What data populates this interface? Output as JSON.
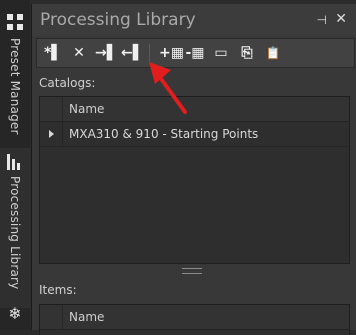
{
  "sidebar": {
    "tabs": [
      {
        "label": "Preset Manager",
        "icon": "grid-icon"
      },
      {
        "label": "Processing Library",
        "icon": "bars-icon",
        "active": true
      },
      {
        "label": "",
        "icon": "snowflake-icon"
      }
    ]
  },
  "panel": {
    "title": "Processing Library",
    "pin_glyph": "⊣",
    "close_glyph": "✕"
  },
  "toolbar": {
    "buttons": [
      {
        "name": "new-icon",
        "glyph": "*▌"
      },
      {
        "name": "delete-icon",
        "glyph": "✕"
      },
      {
        "name": "import-icon",
        "glyph": "→▌"
      },
      {
        "name": "export-icon",
        "glyph": "←▌"
      },
      {
        "name": "add-item-icon",
        "glyph": "+▦"
      },
      {
        "name": "remove-item-icon",
        "glyph": "-▦"
      },
      {
        "name": "window-icon",
        "glyph": "▭"
      },
      {
        "name": "copy-icon",
        "glyph": "⎘"
      },
      {
        "name": "paste-icon",
        "glyph": "📋"
      }
    ]
  },
  "catalogs": {
    "label": "Catalogs:",
    "column_header": "Name",
    "rows": [
      {
        "name": "MXA310 & 910 - Starting Points"
      }
    ]
  },
  "items": {
    "label": "Items:",
    "column_header": "Name"
  },
  "colors": {
    "background": "#383838",
    "annotation_arrow": "#e11d1d"
  }
}
